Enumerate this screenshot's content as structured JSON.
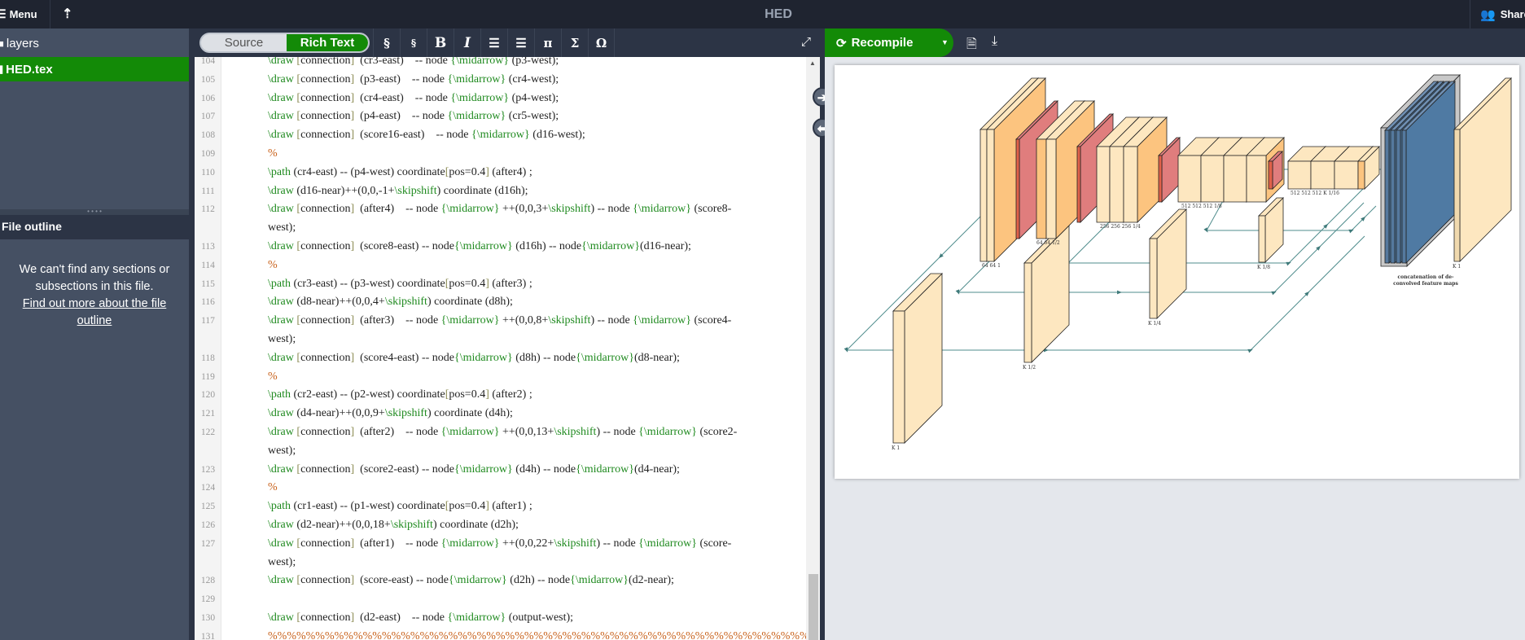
{
  "topbar": {
    "menu_label": "Menu",
    "menu_icon": "menu-icon",
    "up_icon": "arrow-up-icon",
    "title": "HED",
    "share_label": "Share",
    "share_icon": "users-icon"
  },
  "sidebar": {
    "folder_label": "layers",
    "file_label": "HED.tex",
    "active_color": "#138a07"
  },
  "outline": {
    "header": "File outline",
    "message": "We can't find any sections or subsections in this file.",
    "link": "Find out more about the file outline"
  },
  "editor": {
    "toggle": {
      "source": "Source",
      "rich_text": "Rich Text",
      "active": "Rich Text"
    },
    "toolbar": [
      "§",
      "§",
      "B",
      "I",
      "ordered-list",
      "bullet-list",
      "π",
      "Σ",
      "Ω"
    ],
    "toolbar_glyphs": [
      "§",
      "§",
      "B",
      "I",
      "☰",
      "☰",
      "π",
      "Σ",
      "Ω"
    ],
    "lines": [
      {
        "n": "104",
        "text": "\\draw [connection]  (cr3-east)    -- node {\\midarrow} (p3-west);"
      },
      {
        "n": "105",
        "text": "\\draw [connection]  (p3-east)    -- node {\\midarrow} (cr4-west);"
      },
      {
        "n": "106",
        "text": "\\draw [connection]  (cr4-east)    -- node {\\midarrow} (p4-west);"
      },
      {
        "n": "107",
        "text": "\\draw [connection]  (p4-east)    -- node {\\midarrow} (cr5-west);"
      },
      {
        "n": "108",
        "text": "\\draw [connection]  (score16-east)    -- node {\\midarrow} (d16-west);"
      },
      {
        "n": "109",
        "text": "%"
      },
      {
        "n": "110",
        "text": "\\path (cr4-east) -- (p4-west) coordinate[pos=0.4] (after4) ;"
      },
      {
        "n": "111",
        "text": "\\draw (d16-near)++(0,0,-1+\\skipshift) coordinate (d16h);"
      },
      {
        "n": "112",
        "text": "\\draw [connection]  (after4)    -- node {\\midarrow} ++(0,0,3+\\skipshift) -- node {\\midarrow} (score8-west);"
      },
      {
        "n": "113",
        "text": "\\draw [connection]  (score8-east) -- node{\\midarrow} (d16h) -- node{\\midarrow}(d16-near);"
      },
      {
        "n": "114",
        "text": "%"
      },
      {
        "n": "115",
        "text": "\\path (cr3-east) -- (p3-west) coordinate[pos=0.4] (after3) ;"
      },
      {
        "n": "116",
        "text": "\\draw (d8-near)++(0,0,4+\\skipshift) coordinate (d8h);"
      },
      {
        "n": "117",
        "text": "\\draw [connection]  (after3)    -- node {\\midarrow} ++(0,0,8+\\skipshift) -- node {\\midarrow} (score4-west);"
      },
      {
        "n": "118",
        "text": "\\draw [connection]  (score4-east) -- node{\\midarrow} (d8h) -- node{\\midarrow}(d8-near);"
      },
      {
        "n": "119",
        "text": "%"
      },
      {
        "n": "120",
        "text": "\\path (cr2-east) -- (p2-west) coordinate[pos=0.4] (after2) ;"
      },
      {
        "n": "121",
        "text": "\\draw (d4-near)++(0,0,9+\\skipshift) coordinate (d4h);"
      },
      {
        "n": "122",
        "text": "\\draw [connection]  (after2)    -- node {\\midarrow} ++(0,0,13+\\skipshift) -- node {\\midarrow} (score2-west);"
      },
      {
        "n": "123",
        "text": "\\draw [connection]  (score2-east) -- node{\\midarrow} (d4h) -- node{\\midarrow}(d4-near);"
      },
      {
        "n": "124",
        "text": "%"
      },
      {
        "n": "125",
        "text": "\\path (cr1-east) -- (p1-west) coordinate[pos=0.4] (after1) ;"
      },
      {
        "n": "126",
        "text": "\\draw (d2-near)++(0,0,18+\\skipshift) coordinate (d2h);"
      },
      {
        "n": "127",
        "text": "\\draw [connection]  (after1)    -- node {\\midarrow} ++(0,0,22+\\skipshift) -- node {\\midarrow} (score-west);"
      },
      {
        "n": "128",
        "text": "\\draw [connection]  (score-east) -- node{\\midarrow} (d2h) -- node{\\midarrow}(d2-near);"
      },
      {
        "n": "129",
        "text": ""
      },
      {
        "n": "130",
        "text": "\\draw [connection]  (d2-east)    -- node {\\midarrow} (output-west);"
      },
      {
        "n": "131",
        "text": "%%%%%%%%%%%%%%%%%%%%%%%%%%%%%%%%%%%%%%%%%%%%%%%%%%%%%%%%%%%%%%%%"
      }
    ],
    "colors": {
      "command": "#1f8a1f",
      "bracket": "#8c8c55",
      "comment": "#c8611a"
    }
  },
  "pdf": {
    "recompile_label": "Recompile",
    "icons": [
      "refresh-icon",
      "caret-down-icon",
      "file-icon",
      "download-icon"
    ],
    "figure_labels": {
      "conv1": "64 64 1",
      "conv2": "64 64 1/2",
      "conv3": "256 256 256 1/4",
      "conv4": "512 512 512 1/8",
      "conv5": "512 512 512 K 1/16",
      "d8": "K 1/8",
      "d4": "K 1/4",
      "d2": "K 1/2",
      "score": "K 1",
      "output": "K 1",
      "concat_line1": "concatenation of de-",
      "concat_line2": "convolved feature maps"
    }
  }
}
